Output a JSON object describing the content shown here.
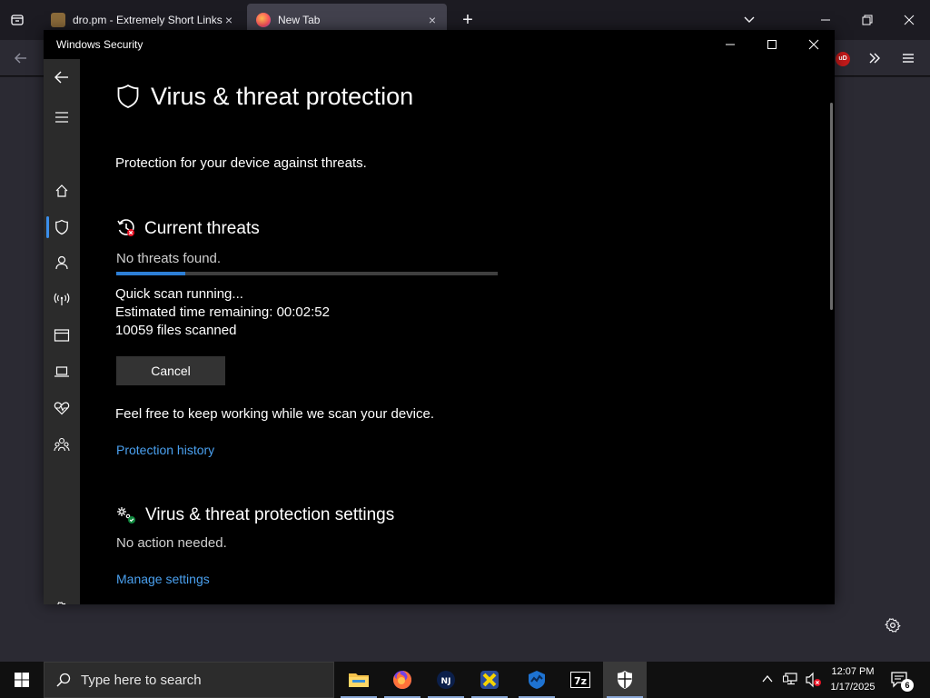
{
  "browser": {
    "tabs": [
      {
        "title": "dro.pm - Extremely Short Links",
        "close": "×"
      },
      {
        "title": "New Tab",
        "close": "×"
      }
    ],
    "new_tab_symbol": "+",
    "ublock_badge": "uD"
  },
  "window": {
    "title": "Windows Security"
  },
  "page": {
    "title": "Virus & threat protection",
    "subtitle": "Protection for your device against threats.",
    "current_threats": {
      "heading": "Current threats",
      "status": "No threats found.",
      "progress": 0.18,
      "scan_status": "Quick scan running...",
      "time_label": "Estimated time remaining:",
      "time_value": "00:02:52",
      "files_count": "10059",
      "files_label": "files scanned",
      "cancel_label": "Cancel",
      "info": "Feel free to keep working while we scan your device.",
      "history_link": "Protection history"
    },
    "settings": {
      "heading": "Virus & threat protection settings",
      "status": "No action needed.",
      "manage_link": "Manage settings"
    }
  },
  "nav": {
    "items": [
      "back-arrow-icon",
      "hamburger-icon",
      "home-icon",
      "shield-icon",
      "account-icon",
      "network-icon",
      "app-browser-icon",
      "device-security-icon",
      "health-icon",
      "family-icon",
      "settings-icon"
    ],
    "selected": "shield-icon"
  },
  "taskbar": {
    "search_placeholder": "Type here to search",
    "apps": [
      "file-explorer-icon",
      "firefox-icon",
      "notepad-js-icon",
      "xampp-icon",
      "hwmonitor-icon",
      "7zip-icon",
      "windows-security-icon"
    ],
    "time": "12:07 PM",
    "date": "1/17/2025",
    "notification_count": "6"
  },
  "colors": {
    "accent": "#2d7fd6",
    "link": "#4aa0ef",
    "window_bg": "#000000",
    "nav_bg": "#2b2b2b"
  }
}
